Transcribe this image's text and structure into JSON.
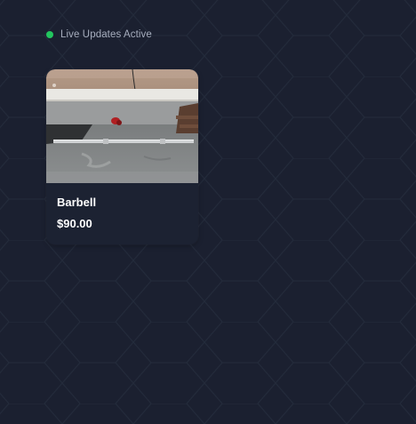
{
  "status": {
    "text": "Live Updates Active",
    "dot_color": "#22c55e"
  },
  "listing": {
    "title": "Barbell",
    "price": "$90.00",
    "image_icon": "barbell-photo"
  },
  "colors": {
    "background": "#1b2030",
    "hex_pattern": "#222a3b",
    "card": "#1c2232",
    "text": "#ffffff",
    "muted_text": "#a6adbd"
  }
}
